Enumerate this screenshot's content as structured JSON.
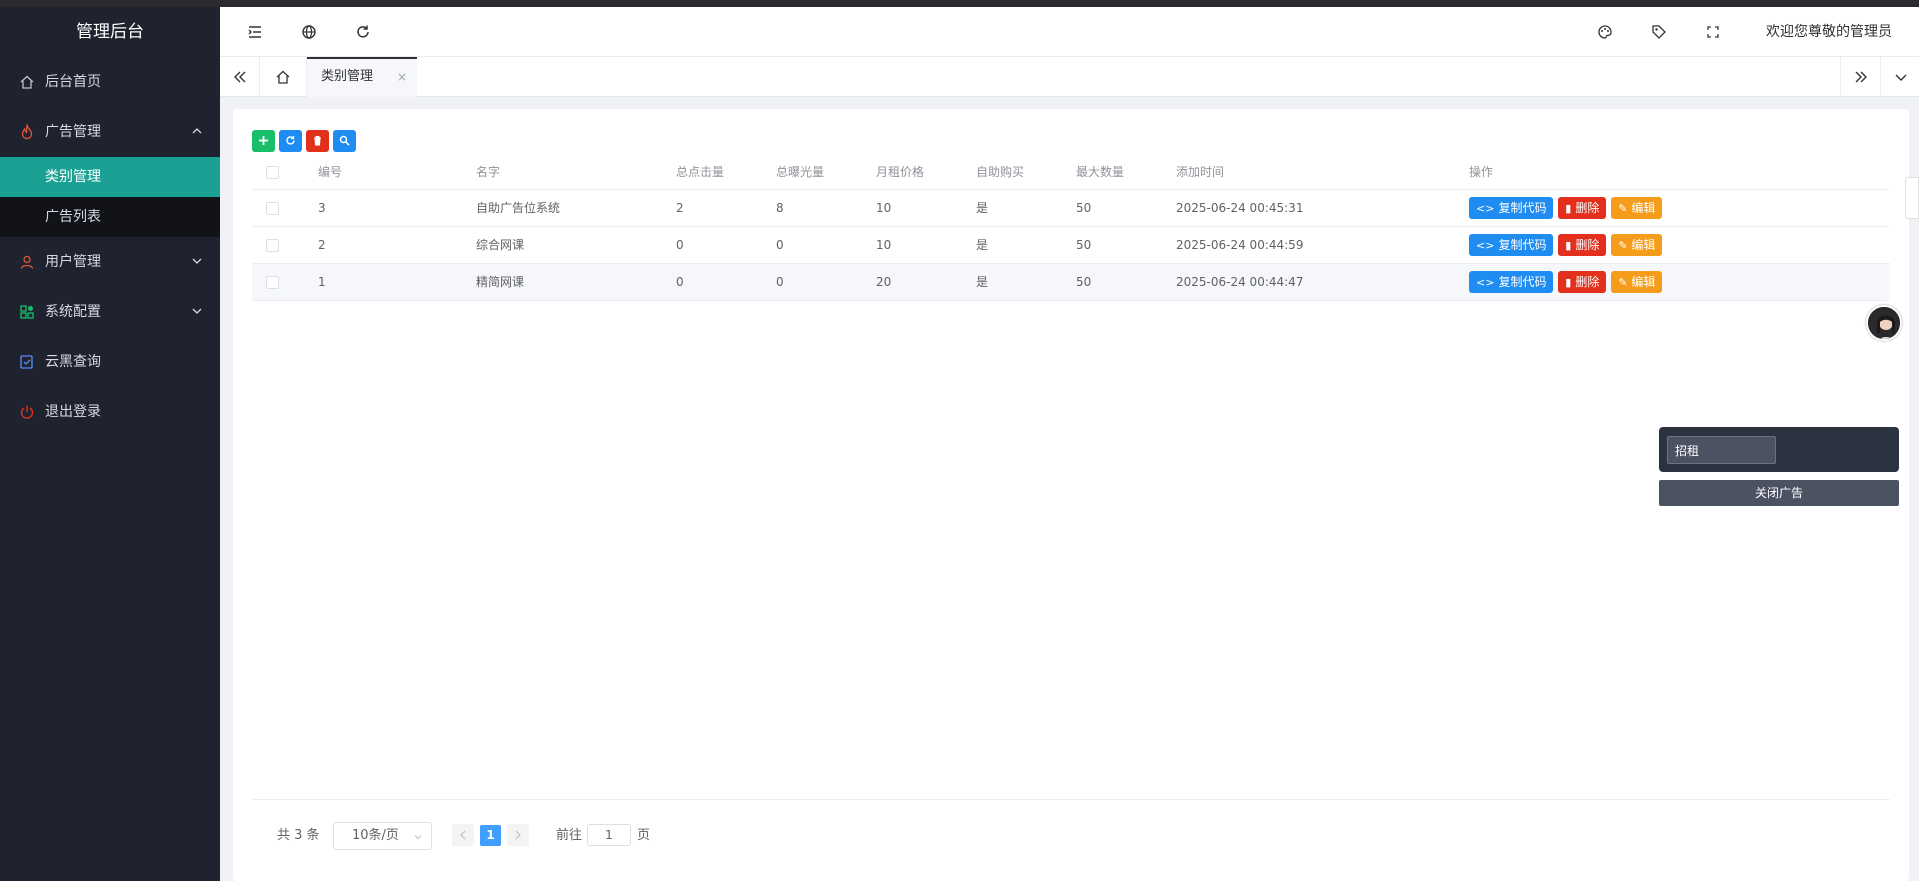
{
  "app": {
    "title": "管理后台"
  },
  "sidebar": {
    "items": [
      {
        "label": "后台首页",
        "icon": "home-icon"
      },
      {
        "label": "广告管理",
        "icon": "fire-icon",
        "expanded": true,
        "children": [
          {
            "label": "类别管理",
            "active": true
          },
          {
            "label": "广告列表"
          }
        ]
      },
      {
        "label": "用户管理",
        "icon": "user-icon"
      },
      {
        "label": "系统配置",
        "icon": "settings-grid-icon"
      },
      {
        "label": "云黑查询",
        "icon": "cloud-check-icon"
      },
      {
        "label": "退出登录",
        "icon": "power-icon"
      }
    ]
  },
  "header": {
    "welcome": "欢迎您尊敬的管理员"
  },
  "tabs": {
    "active_label": "类别管理",
    "close": "×"
  },
  "table": {
    "headers": [
      "编号",
      "名字",
      "总点击量",
      "总曝光量",
      "月租价格",
      "自助购买",
      "最大数量",
      "添加时间",
      "操作"
    ],
    "rows": [
      [
        "3",
        "自助广告位系统",
        "2",
        "8",
        "10",
        "是",
        "50",
        "2025-06-24 00:45:31"
      ],
      [
        "2",
        "综合网课",
        "0",
        "0",
        "10",
        "是",
        "50",
        "2025-06-24 00:44:59"
      ],
      [
        "1",
        "精简网课",
        "0",
        "0",
        "20",
        "是",
        "50",
        "2025-06-24 00:44:47"
      ]
    ],
    "actions": {
      "copy": "复制代码",
      "delete": "删除",
      "edit": "编辑"
    }
  },
  "pagination": {
    "total": "共 3 条",
    "page_size": "10条/页",
    "current_page": "1",
    "goto_label": "前往",
    "goto_value": "1",
    "page_suffix": "页"
  },
  "ad_widget": {
    "input_value": "招租",
    "close_label": "关闭广告"
  },
  "colors": {
    "sidebar_bg": "#1f2330",
    "active_menu": "#1aa194",
    "fire_icon": "#e2543a",
    "btn_green": "#19be6b",
    "btn_blue": "#1e8cf0",
    "btn_red": "#e2301d",
    "btn_orange": "#f59c1a"
  }
}
